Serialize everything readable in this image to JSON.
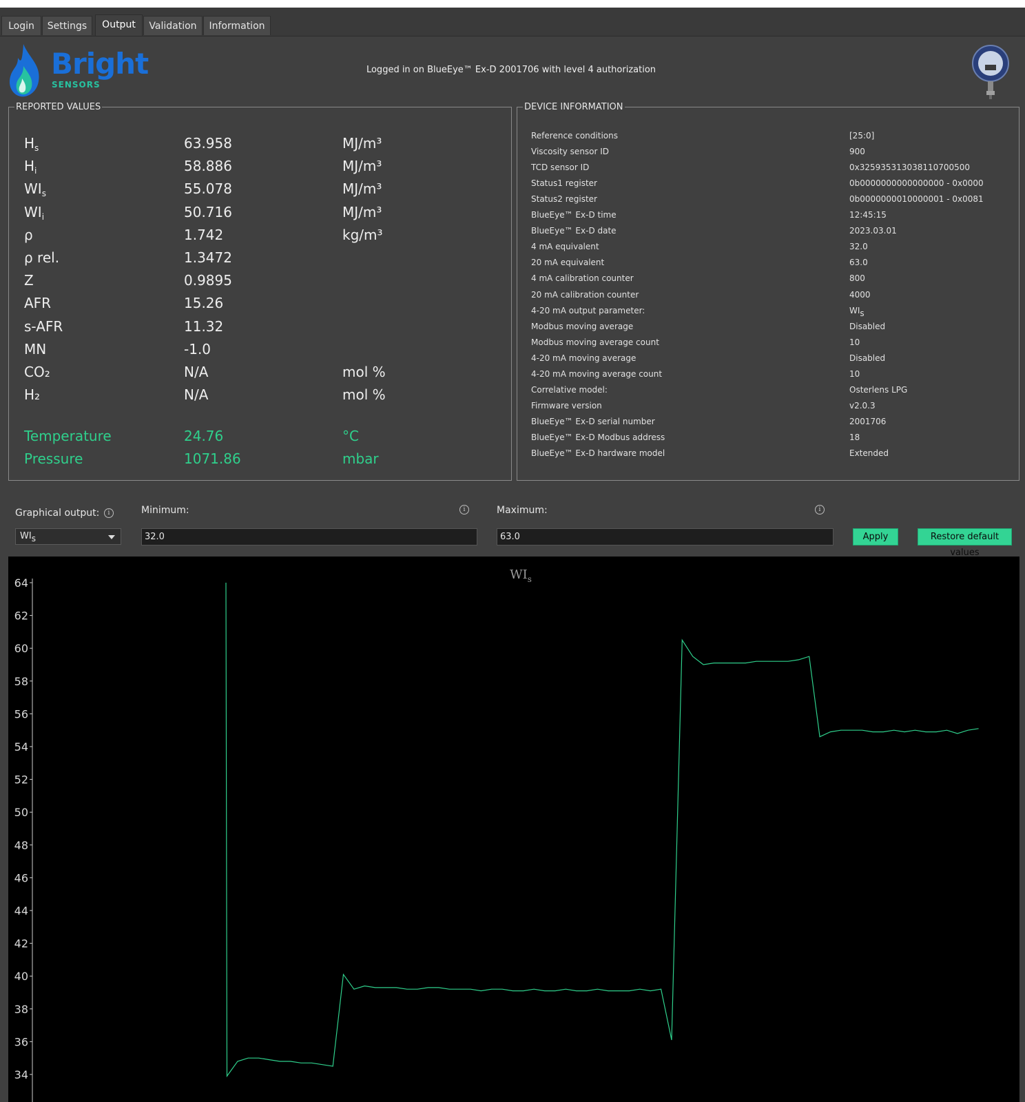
{
  "tabs": [
    {
      "label": "Login",
      "active": false
    },
    {
      "label": "Settings",
      "active": false
    },
    {
      "label": "Output",
      "active": true
    },
    {
      "label": "Validation",
      "active": false
    },
    {
      "label": "Information",
      "active": false
    }
  ],
  "header": {
    "logo_word": "Bright",
    "logo_sub": "SENSORS",
    "login_status": "Logged in on BlueEye™ Ex-D 2001706 with level 4 authorization"
  },
  "reported_values": {
    "title": "REPORTED VALUES",
    "rows": [
      {
        "name": "H",
        "sub": "s",
        "value": "63.958",
        "unit": "MJ/m³"
      },
      {
        "name": "H",
        "sub": "i",
        "value": "58.886",
        "unit": "MJ/m³"
      },
      {
        "name": "WI",
        "sub": "s",
        "value": "55.078",
        "unit": "MJ/m³"
      },
      {
        "name": "WI",
        "sub": "i",
        "value": "50.716",
        "unit": "MJ/m³"
      },
      {
        "name": "ρ",
        "sub": "",
        "value": "1.742",
        "unit": "kg/m³"
      },
      {
        "name": "ρ rel.",
        "sub": "",
        "value": "1.3472",
        "unit": ""
      },
      {
        "name": "Z",
        "sub": "",
        "value": "0.9895",
        "unit": ""
      },
      {
        "name": "AFR",
        "sub": "",
        "value": "15.26",
        "unit": ""
      },
      {
        "name": "s-AFR",
        "sub": "",
        "value": "11.32",
        "unit": ""
      },
      {
        "name": "MN",
        "sub": "",
        "value": "-1.0",
        "unit": ""
      },
      {
        "name": "CO₂",
        "sub": "",
        "value": "N/A",
        "unit": "mol %"
      },
      {
        "name": "H₂",
        "sub": "",
        "value": "N/A",
        "unit": "mol %"
      }
    ],
    "measured": [
      {
        "name": "Temperature",
        "value": "24.76",
        "unit": "°C"
      },
      {
        "name": "Pressure",
        "value": "1071.86",
        "unit": "mbar"
      }
    ],
    "measured_color": "#2fd08c"
  },
  "device_information": {
    "title": "DEVICE INFORMATION",
    "rows": [
      {
        "key": "Reference conditions",
        "value": "[25:0]"
      },
      {
        "key": "Viscosity sensor ID",
        "value": "900"
      },
      {
        "key": "TCD sensor ID",
        "value": "0x325935313038110700500"
      },
      {
        "key": "Status1 register",
        "value": "0b0000000000000000 - 0x0000"
      },
      {
        "key": "Status2 register",
        "value": "0b0000000010000001 - 0x0081"
      },
      {
        "key": "BlueEye™ Ex-D time",
        "value": "12:45:15"
      },
      {
        "key": "BlueEye™ Ex-D date",
        "value": "2023.03.01"
      },
      {
        "key": "4 mA equivalent",
        "value": "32.0"
      },
      {
        "key": "20 mA equivalent",
        "value": "63.0"
      },
      {
        "key": "4 mA calibration counter",
        "value": "800"
      },
      {
        "key": "20 mA calibration counter",
        "value": "4000"
      },
      {
        "key": "4-20 mA output parameter:",
        "value": "WIs"
      },
      {
        "key": "Modbus moving average",
        "value": "Disabled"
      },
      {
        "key": "Modbus moving average count",
        "value": "10"
      },
      {
        "key": "4-20 mA moving average",
        "value": "Disabled"
      },
      {
        "key": "4-20 mA moving average count",
        "value": "10"
      },
      {
        "key": "Correlative model:",
        "value": "Osterlens LPG"
      },
      {
        "key": "Firmware version",
        "value": "v2.0.3"
      },
      {
        "key": "BlueEye™ Ex-D serial number",
        "value": "2001706"
      },
      {
        "key": "BlueEye™ Ex-D Modbus address",
        "value": "18"
      },
      {
        "key": "BlueEye™ Ex-D hardware model",
        "value": "Extended"
      }
    ]
  },
  "controls": {
    "graphical_output_label": "Graphical output:",
    "graphical_output_value": "WIs",
    "minimum_label": "Minimum:",
    "minimum_value": "32.0",
    "maximum_label": "Maximum:",
    "maximum_value": "63.0",
    "apply_label": "Apply",
    "restore_label": "Restore default values",
    "button_color": "#33d494"
  },
  "chart_data": {
    "type": "line",
    "title": "WIs",
    "xlabel": "",
    "ylabel": "",
    "ylim": [
      33,
      64
    ],
    "yticks": [
      64,
      62,
      60,
      58,
      56,
      54,
      52,
      50,
      48,
      46,
      44,
      42,
      40,
      38,
      36,
      34
    ],
    "grid": false,
    "line_color": "#2fd08c",
    "series": [
      {
        "values": [
          64.0,
          33.9,
          34.8,
          35.0,
          35.0,
          34.9,
          34.8,
          34.8,
          34.7,
          34.7,
          34.6,
          34.5,
          40.1,
          39.2,
          39.4,
          39.3,
          39.3,
          39.3,
          39.2,
          39.2,
          39.3,
          39.3,
          39.2,
          39.2,
          39.2,
          39.1,
          39.2,
          39.2,
          39.1,
          39.1,
          39.2,
          39.1,
          39.1,
          39.2,
          39.1,
          39.1,
          39.2,
          39.1,
          39.1,
          39.1,
          39.2,
          39.1,
          39.2,
          36.1,
          60.5,
          59.5,
          59.0,
          59.1,
          59.1,
          59.1,
          59.1,
          59.2,
          59.2,
          59.2,
          59.2,
          59.3,
          59.5,
          54.6,
          54.9,
          55.0,
          55.0,
          55.0,
          54.9,
          54.9,
          55.0,
          54.9,
          55.0,
          54.9,
          54.9,
          55.0,
          54.8,
          55.0,
          55.1
        ]
      }
    ]
  }
}
